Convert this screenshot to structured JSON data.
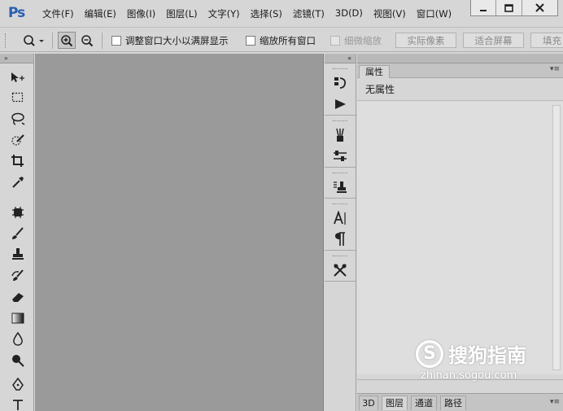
{
  "app": {
    "logo": "Ps"
  },
  "menu": [
    "文件(F)",
    "编辑(E)",
    "图像(I)",
    "图层(L)",
    "文字(Y)",
    "选择(S)",
    "滤镜(T)",
    "3D(D)",
    "视图(V)",
    "窗口(W)"
  ],
  "window_controls": {
    "minimize": "minimize-icon",
    "maximize": "maximize-icon",
    "close": "close-icon"
  },
  "options": {
    "resize_windows": "调整窗口大小以满屏显示",
    "zoom_all": "缩放所有窗口",
    "scrubby_zoom": "细微缩放",
    "actual_pixels": "实际像素",
    "fit_screen": "适合屏幕",
    "fill_screen": "填充"
  },
  "panels": {
    "collapse_left": "»",
    "collapse_right": "«",
    "properties_tab": "属性",
    "properties_empty": "无属性",
    "panel_menu": "▾≡"
  },
  "layers_tabs": [
    "3D",
    "图层",
    "通道",
    "路径"
  ],
  "watermark": {
    "brand": "搜狗指南",
    "url": "zhinan.sogou.com"
  },
  "colors": {
    "logo": "#2a5fb0",
    "canvas": "#9a9a9a",
    "chrome": "#d6d6d6"
  }
}
